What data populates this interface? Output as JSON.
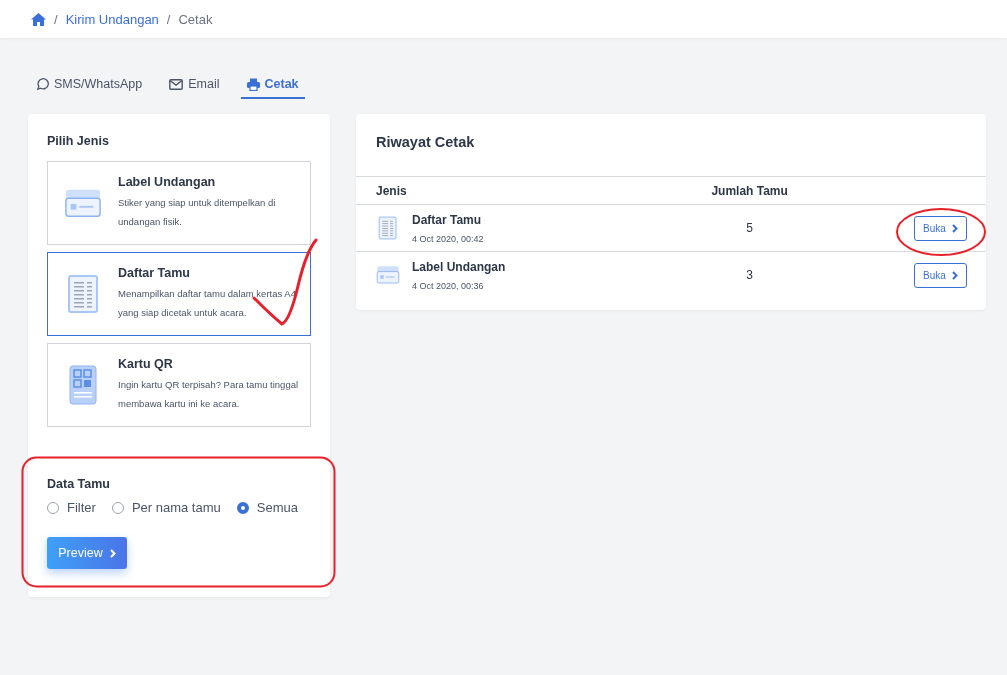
{
  "breadcrumb": [
    {
      "separator": "/",
      "label": "Kirim Undangan",
      "kind": "link"
    },
    {
      "separator": "/",
      "label": "Cetak",
      "kind": "current"
    }
  ],
  "tabs": [
    {
      "label": "SMS/WhatsApp",
      "kind": "whatsapp",
      "selected": false
    },
    {
      "label": "Email",
      "kind": "mail",
      "selected": false
    },
    {
      "label": "Cetak",
      "kind": "printer",
      "selected": true
    }
  ],
  "pilih_jenis": {
    "title": "Pilih Jenis",
    "options": [
      {
        "title": "Label Undangan",
        "description": "Stiker yang siap untuk ditempelkan di undangan fisik.",
        "kind": "label",
        "selected": false
      },
      {
        "title": "Daftar Tamu",
        "description": "Menampilkan daftar tamu dalam kertas A4 yang siap dicetak untuk acara.",
        "kind": "list",
        "selected": true
      },
      {
        "title": "Kartu QR",
        "description": "Ingin kartu QR terpisah? Para tamu tinggal membawa kartu ini ke acara.",
        "kind": "qr",
        "selected": false
      }
    ]
  },
  "data_tamu": {
    "title": "Data Tamu",
    "options": [
      {
        "label": "Filter",
        "selected": false
      },
      {
        "label": "Per nama tamu",
        "selected": false
      },
      {
        "label": "Semua",
        "selected": true
      }
    ],
    "button": "Preview"
  },
  "riwayat": {
    "title": "Riwayat Cetak",
    "columns": [
      "Jenis",
      "Jumlah Tamu"
    ],
    "rows": [
      {
        "name": "Daftar Tamu",
        "date": "4 Oct 2020, 00:42",
        "kind": "list",
        "count": "5",
        "button": "Buka"
      },
      {
        "name": "Label Undangan",
        "date": "4 Oct 2020, 00:36",
        "kind": "label",
        "count": "3",
        "button": "Buka"
      }
    ]
  }
}
